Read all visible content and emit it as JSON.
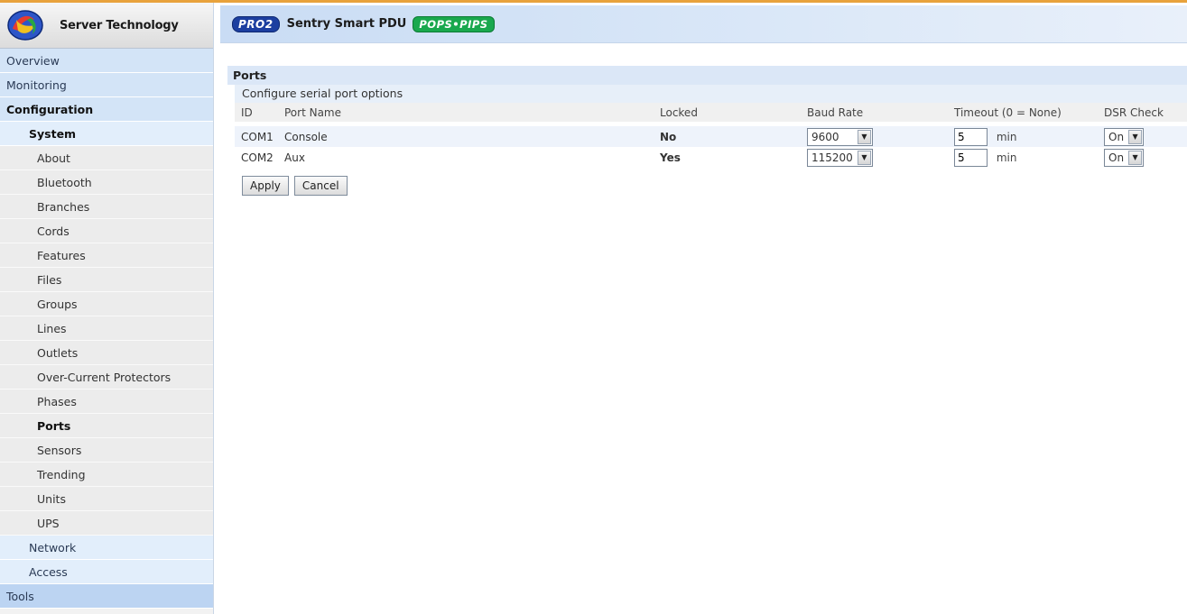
{
  "brand": {
    "name": "Server Technology"
  },
  "header": {
    "pro_badge": "PRO2",
    "title": "Sentry Smart PDU",
    "pops_badge": "POPS•PIPS"
  },
  "sidebar": {
    "overview": "Overview",
    "monitoring": "Monitoring",
    "configuration": "Configuration",
    "system": "System",
    "items": [
      "About",
      "Bluetooth",
      "Branches",
      "Cords",
      "Features",
      "Files",
      "Groups",
      "Lines",
      "Outlets",
      "Over-Current Protectors",
      "Phases",
      "Ports",
      "Sensors",
      "Trending",
      "Units",
      "UPS"
    ],
    "network": "Network",
    "access": "Access",
    "tools": "Tools"
  },
  "section": {
    "title": "Ports",
    "subtitle": "Configure serial port options"
  },
  "table": {
    "headers": {
      "id": "ID",
      "port_name": "Port Name",
      "locked": "Locked",
      "baud_rate": "Baud Rate",
      "timeout": "Timeout (0 = None)",
      "dsr_check": "DSR Check"
    },
    "rows": [
      {
        "id": "COM1",
        "port_name": "Console",
        "locked": "No",
        "baud_rate": "9600",
        "timeout": "5",
        "timeout_unit": "min",
        "dsr_check": "On"
      },
      {
        "id": "COM2",
        "port_name": "Aux",
        "locked": "Yes",
        "baud_rate": "115200",
        "timeout": "5",
        "timeout_unit": "min",
        "dsr_check": "On"
      }
    ]
  },
  "buttons": {
    "apply": "Apply",
    "cancel": "Cancel"
  },
  "colors": {
    "accent_line": "#e8a23c",
    "nav_top": "#d3e4f7",
    "header_bg": "#c9dcf4"
  }
}
